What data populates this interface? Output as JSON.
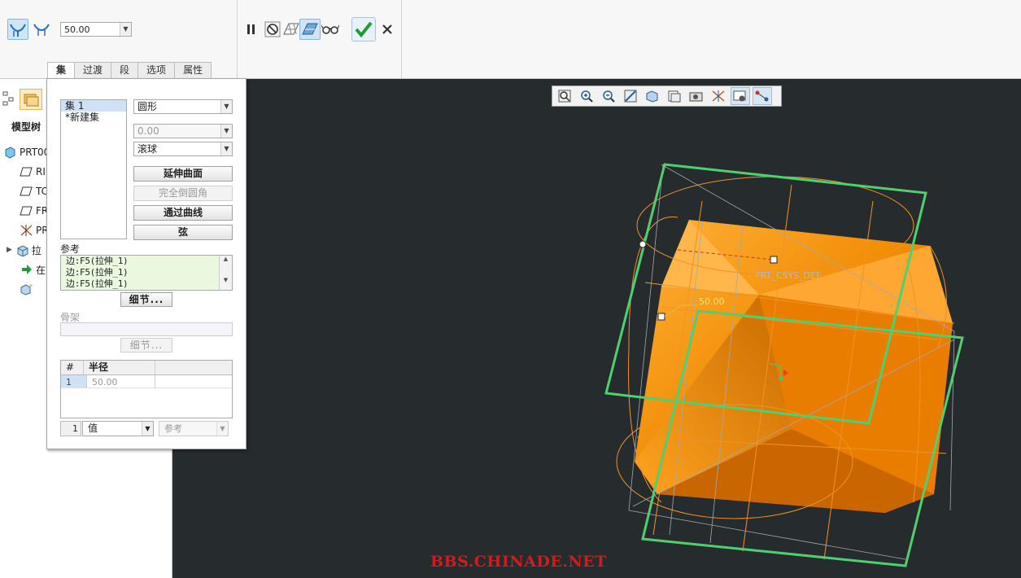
{
  "ribbon": {
    "value": "50.00",
    "tabs": [
      "集",
      "过渡",
      "段",
      "选项",
      "属性"
    ]
  },
  "model_tree": {
    "title": "模型树",
    "items": [
      {
        "label": "PRT00",
        "icon": "part-icon"
      },
      {
        "label": "RI",
        "icon": "datum-plane-icon"
      },
      {
        "label": "TC",
        "icon": "datum-plane-icon"
      },
      {
        "label": "FR",
        "icon": "datum-plane-icon"
      },
      {
        "label": "PR",
        "icon": "csys-icon"
      },
      {
        "label": "拉",
        "icon": "extrude-icon"
      },
      {
        "label": "在",
        "icon": "insert-here-icon"
      },
      {
        "label": "",
        "icon": "round-feature-icon"
      }
    ]
  },
  "panel": {
    "sets": [
      "集 1",
      "*新建集"
    ],
    "shape_combo": "圆形",
    "value_combo": "0.00",
    "method_combo": "滚球",
    "buttons": {
      "extend_surface": "延伸曲面",
      "full_round": "完全倒圆角",
      "through_curve": "通过曲线",
      "chord": "弦"
    },
    "references_label": "参考",
    "references": [
      "边:F5(拉伸_1)",
      "边:F5(拉伸_1)",
      "边:F5(拉伸_1)"
    ],
    "details_label": "细节...",
    "spine_label": "骨架",
    "radius_table": {
      "headers": [
        "#",
        "半径"
      ],
      "rows": [
        {
          "num": "1",
          "radius": "50.00"
        }
      ]
    },
    "bottom": {
      "index": "1",
      "value_combo": "值",
      "ref_combo": "参考"
    }
  },
  "graphics": {
    "dimension": "50.00",
    "csys_label": "PRT_CSYS_DEF",
    "watermark": "BBS.CHINADE.NET"
  },
  "colors": {
    "accent": "#3a7fc1",
    "round_geometry": "#4fd06e",
    "part": "#f08a00",
    "background": "#262b2e"
  }
}
